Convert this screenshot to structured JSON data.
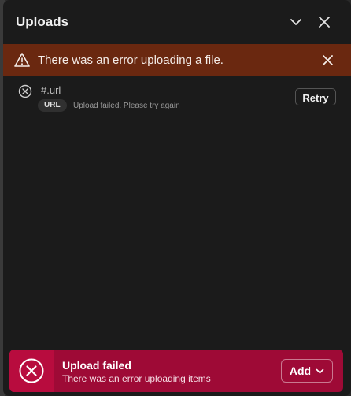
{
  "header": {
    "title": "Uploads",
    "collapse_icon": "chevron-down-icon",
    "close_icon": "close-icon"
  },
  "alert": {
    "message": "There was an error uploading a file.",
    "icon": "warning-icon",
    "dismiss_icon": "close-icon",
    "color": "#6a2810"
  },
  "uploads": [
    {
      "name": "#.url",
      "type_badge": "URL",
      "status_text": "Upload failed. Please try again",
      "status_icon": "error-circle-icon",
      "action_label": "Retry"
    }
  ],
  "toast": {
    "title": "Upload failed",
    "message": "There was an error uploading items",
    "icon": "error-circle-icon",
    "add_label": "Add",
    "add_icon": "chevron-down-icon",
    "color": "#9e0a36"
  }
}
